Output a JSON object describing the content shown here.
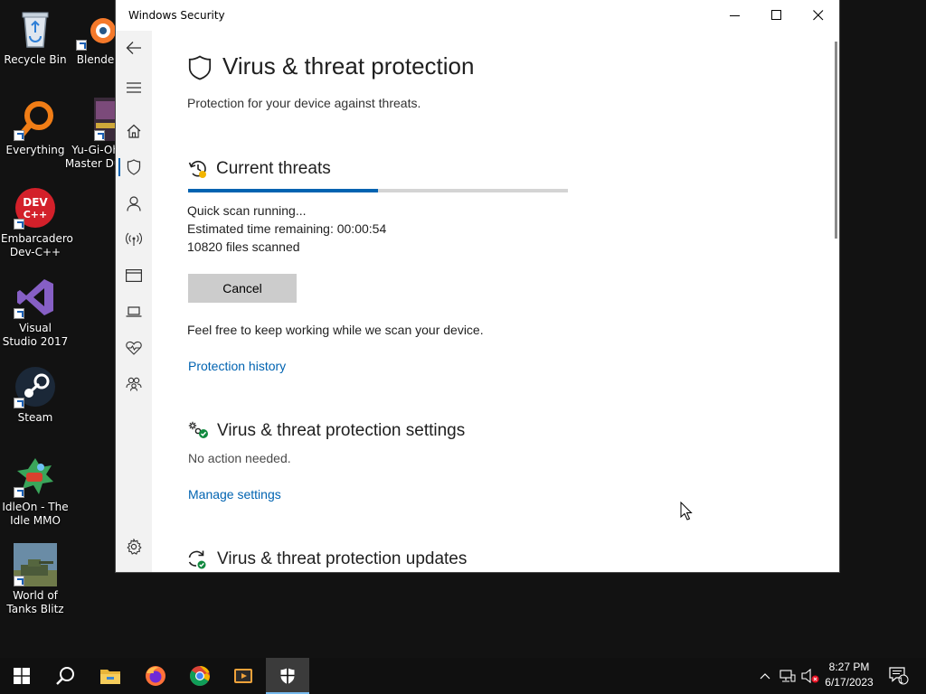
{
  "desktop": {
    "icons": [
      {
        "label": "Recycle Bin"
      },
      {
        "label": "Blender"
      },
      {
        "label": "Everything"
      },
      {
        "label": "Yu-Gi-Oh! Master Duel"
      },
      {
        "label": "Embarcadero Dev-C++"
      },
      {
        "label": "Visual Studio 2017"
      },
      {
        "label": "Steam"
      },
      {
        "label": "IdleOn - The Idle MMO"
      },
      {
        "label": "World of Tanks Blitz"
      }
    ]
  },
  "window": {
    "title": "Windows Security",
    "minimize_icon": "minimize-icon",
    "maximize_icon": "maximize-icon",
    "close_icon": "close-icon"
  },
  "nav": {
    "items": [
      {
        "icon": "back-arrow-icon"
      },
      {
        "icon": "hamburger-menu-icon"
      },
      {
        "icon": "home-icon"
      },
      {
        "icon": "shield-icon",
        "active": true
      },
      {
        "icon": "person-icon"
      },
      {
        "icon": "wireless-icon"
      },
      {
        "icon": "app-browser-icon"
      },
      {
        "icon": "laptop-icon"
      },
      {
        "icon": "heart-pulse-icon"
      },
      {
        "icon": "family-icon"
      },
      {
        "icon": "gear-icon"
      }
    ]
  },
  "page": {
    "title": "Virus & threat protection",
    "subtitle": "Protection for your device against threats."
  },
  "current_threats": {
    "title": "Current threats",
    "progress_fraction": 0.5,
    "status": "Quick scan running...",
    "time_remaining_label": "Estimated time remaining:  00:00:54",
    "files_scanned": "10820  files scanned",
    "cancel_label": "Cancel",
    "note": "Feel free to keep working while we scan your device.",
    "history_link": "Protection history"
  },
  "settings": {
    "title": "Virus & threat protection settings",
    "status": "No action needed.",
    "manage_link": "Manage settings"
  },
  "updates": {
    "title": "Virus & threat protection updates"
  },
  "taskbar": {
    "time": "8:27 PM",
    "date": "6/17/2023",
    "notification_count": "1"
  },
  "colors": {
    "accent": "#0063b1",
    "progress_track": "#d4d4d4",
    "button_bg": "#cccccc",
    "ok_green": "#10893e"
  }
}
